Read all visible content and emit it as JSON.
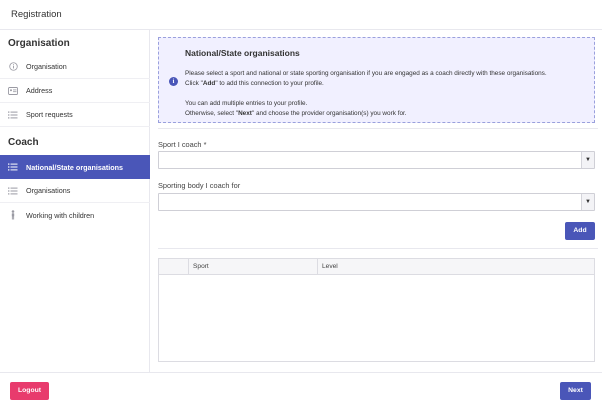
{
  "header": {
    "title": "Registration"
  },
  "sidebar": {
    "organisation_title": "Organisation",
    "organisation_items": [
      {
        "label": "Organisation",
        "icon": "info-circle-icon"
      },
      {
        "label": "Address",
        "icon": "address-card-icon"
      },
      {
        "label": "Sport requests",
        "icon": "list-icon"
      }
    ],
    "coach_title": "Coach",
    "coach_items": [
      {
        "label": "National/State organisations",
        "icon": "list-icon",
        "active": true
      },
      {
        "label": "Organisations",
        "icon": "list-icon"
      },
      {
        "label": "Working with children",
        "icon": "child-icon"
      }
    ]
  },
  "info": {
    "heading": "National/State organisations",
    "line1": "Please select a sport and national or state sporting organisation if you are engaged as a coach directly with these organisations.",
    "line2_pre": "Click \"",
    "line2_bold": "Add",
    "line2_post": "\" to add this connection to your profile.",
    "line3": "You can add multiple entries to your profile.",
    "line4_pre": "Otherwise, select \"",
    "line4_bold": "Next",
    "line4_post": "\" and choose the provider organisation(s) you work for."
  },
  "form": {
    "sport_label": "Sport I coach *",
    "sport_value": "",
    "body_label": "Sporting body I coach for",
    "body_value": "",
    "add_label": "Add"
  },
  "table": {
    "columns": [
      "",
      "Sport",
      "Level"
    ],
    "rows": []
  },
  "footer": {
    "logout_label": "Logout",
    "next_label": "Next"
  },
  "colors": {
    "accent": "#4a56b8",
    "danger": "#e83b6d",
    "info_bg": "#f1f0ff"
  }
}
